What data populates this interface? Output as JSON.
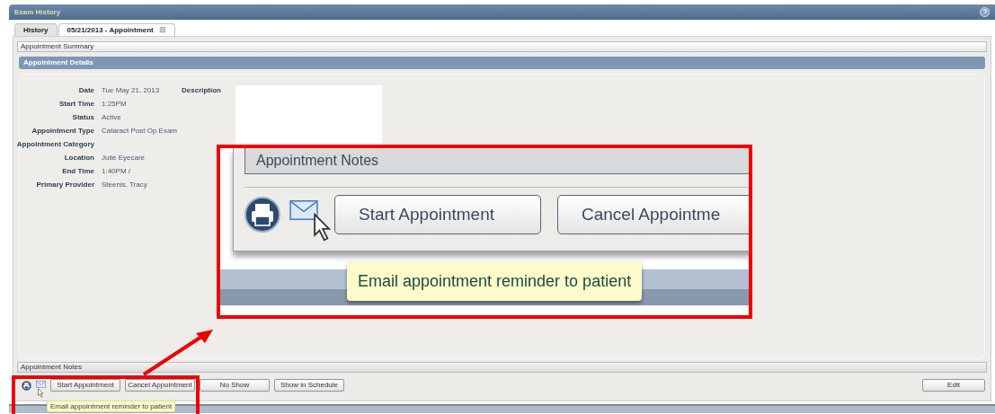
{
  "window": {
    "title": "Exam History"
  },
  "tabs": [
    {
      "label": "History",
      "selected": false
    },
    {
      "label": "05/21/2013 - Appointment",
      "selected": true,
      "close_symbol": "⊠"
    }
  ],
  "summary_bar": "Appointment Summary",
  "details_header": "Appointment Details",
  "fields": [
    {
      "label": "Date",
      "value": "Tue May 21, 2013"
    },
    {
      "label": "Start Time",
      "value": "1:25PM"
    },
    {
      "label": "Status",
      "value": "Active"
    },
    {
      "label": "Appointment Type",
      "value": "Cataract Post Op Exam"
    },
    {
      "label": "Appointment Category"
    },
    {
      "label": "Location",
      "value": "Julie Eyecare"
    },
    {
      "label": "End Time",
      "value": "1:40PM /"
    },
    {
      "label": "Primary Provider",
      "value": "Steenis, Tracy"
    }
  ],
  "description_label": "Description",
  "notes_bar": "Appointment Notes",
  "toolbar": {
    "buttons": [
      "Start Appointment",
      "Cancel Appointment",
      "No Show",
      "Show in Schedule"
    ],
    "edit": "Edit",
    "tooltip": "Email appointment reminder to patient"
  },
  "callout": {
    "notes_bar": "Appointment Notes",
    "buttons": [
      "Start Appointment",
      "Cancel Appointme"
    ],
    "tooltip": "Email appointment reminder to patient"
  }
}
